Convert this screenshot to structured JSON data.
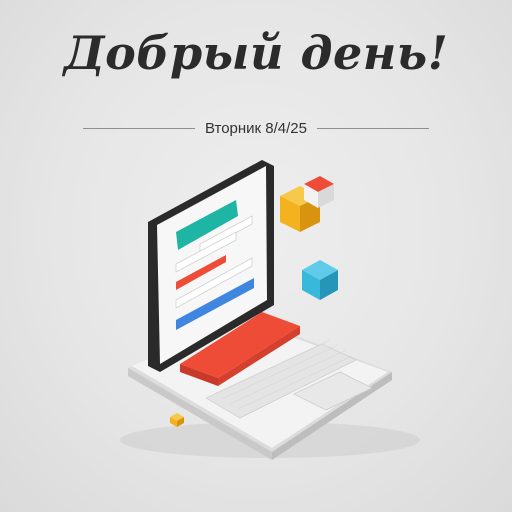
{
  "greeting": "Добрый день!",
  "date_text": "Вторник 8/4/25",
  "colors": {
    "background": "#e6e6e6",
    "teal": "#1fb5a5",
    "red": "#ee4c36",
    "blue": "#3f86e0",
    "orange": "#f4b21f",
    "cube_blue": "#38b8db",
    "laptop_body": "#f2f2f2",
    "bezel": "#2b2b2b"
  },
  "illustration": {
    "icons": [
      "laptop-icon",
      "tablet-screen-icon",
      "keyboard-icon",
      "touchpad-icon",
      "cube-icon"
    ]
  }
}
